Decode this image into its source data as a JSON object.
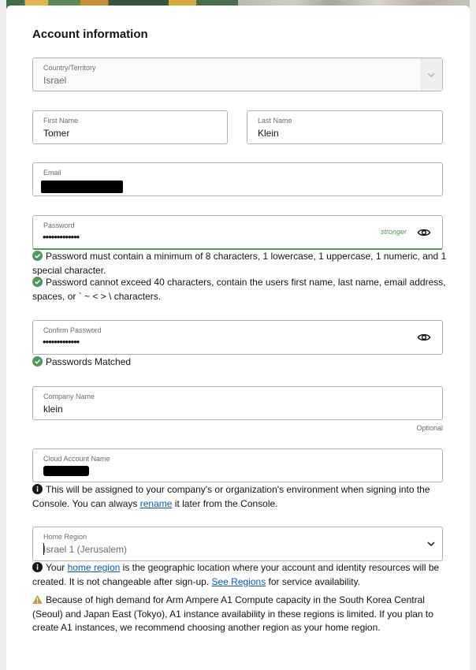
{
  "page": {
    "title": "Account information"
  },
  "country": {
    "label": "Country/Territory",
    "value": "Israel"
  },
  "first_name": {
    "label": "First Name",
    "value": "Tomer"
  },
  "last_name": {
    "label": "Last Name",
    "value": "Klein"
  },
  "email": {
    "label": "Email"
  },
  "password": {
    "label": "Password",
    "value": "•••••••••••••",
    "strength": "stronger",
    "rule1": "Password must contain a minimum of 8 characters, 1 lowercase, 1 uppercase, 1 numeric, and 1 special character.",
    "rule2": "Password cannot exceed 40 characters, contain the users first name, last name, email address, spaces, or ` ~ < > \\ characters."
  },
  "confirm_password": {
    "label": "Confirm Password",
    "value": "•••••••••••••",
    "matched": "Passwords Matched"
  },
  "company": {
    "label": "Company Name",
    "value": "klein",
    "optional": "Optional"
  },
  "cloud_account": {
    "label": "Cloud Account Name",
    "info_prefix": "This will be assigned to your company's or organization's environment when signing into the Console. You can always ",
    "info_link": "rename",
    "info_suffix": " it later from the Console."
  },
  "home_region": {
    "label": "Home Region",
    "placeholder": "Israel 1 (Jerusalem)",
    "info_prefix": "Your ",
    "info_link1": "home region",
    "info_middle": " is the geographic location where your account and identity resources will be created. It is not changeable after sign-up. ",
    "info_link2": "See Regions",
    "info_suffix": " for service availability.",
    "warning": "Because of high demand for Arm Ampere A1 Compute capacity in the South Korea Central (Seoul) and Japan East (Tokyo), A1 instance availability in these regions is limited. If you plan to create A1 instances, we recommend choosing another region as your home region."
  },
  "colors": {
    "success": "#4c9a5e",
    "link": "#0a5bb8",
    "warning": "#c29a3b"
  },
  "icons": {
    "check": "check-circle-icon",
    "info": "info-circle-icon",
    "warn": "warning-triangle-icon",
    "eye": "eye-icon",
    "chevron": "chevron-down-icon"
  }
}
